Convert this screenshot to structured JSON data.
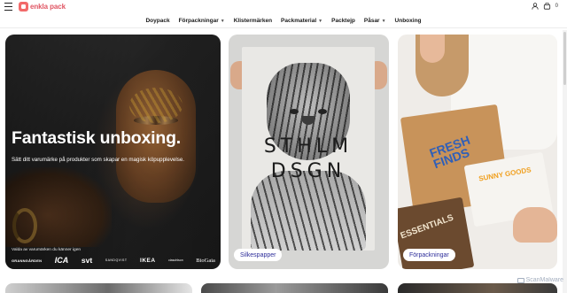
{
  "header": {
    "logo_text": "enkla pack",
    "cart_count": "0"
  },
  "nav": {
    "items": [
      {
        "label": "Doypack",
        "has_dropdown": false
      },
      {
        "label": "Förpackningar",
        "has_dropdown": true
      },
      {
        "label": "Klistermärken",
        "has_dropdown": false
      },
      {
        "label": "Packmaterial",
        "has_dropdown": true
      },
      {
        "label": "Packtejp",
        "has_dropdown": false
      },
      {
        "label": "Påsar",
        "has_dropdown": true
      },
      {
        "label": "Unboxing",
        "has_dropdown": false
      }
    ]
  },
  "hero": {
    "title": "Fantastisk unboxing.",
    "subtitle": "Sätt ditt varumärke på produkter som skapar en magisk köpupplevelse.",
    "trust_label": "Valda av varumärken du känner igen",
    "brands": [
      "GRANNGÅRDEN",
      "ICA",
      "svt",
      "SANDQVIST",
      "IKEA",
      "clasohlson",
      "BioGaia"
    ]
  },
  "tiles": {
    "tiger": {
      "poster_line1": "STHLM",
      "poster_line2": "DSGN",
      "pill": "Silkespapper"
    },
    "boxes": {
      "box1_text": "FRESH FINDS",
      "box2_text": "SUNNY GOODS",
      "box3_text": "ESSENTIALS",
      "pill": "Förpackningar"
    }
  },
  "watermark": {
    "text": "ScanMalware"
  },
  "colors": {
    "brand": "#e05563",
    "pill_text": "#2d2d9a",
    "box_logo_blue": "#2f5fb8",
    "box_logo_orange": "#f0a020"
  }
}
